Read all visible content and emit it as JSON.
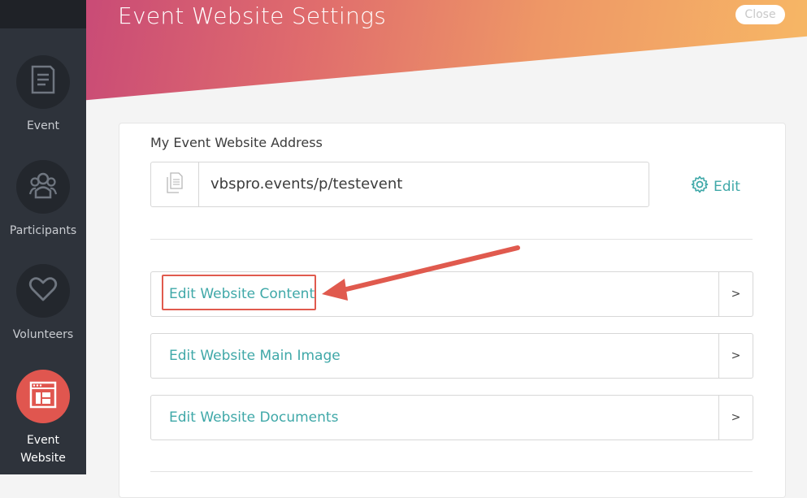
{
  "sidebar": {
    "items": [
      {
        "label": "Event",
        "icon": "document-icon",
        "active": false
      },
      {
        "label": "Participants",
        "icon": "people-icon",
        "active": false
      },
      {
        "label": "Volunteers",
        "icon": "heart-icon",
        "active": false
      },
      {
        "label": "Event\nWebsite",
        "icon": "website-icon",
        "active": true
      }
    ]
  },
  "header": {
    "title": "Event Website Settings",
    "close_label": "Close"
  },
  "address": {
    "label": "My Event Website Address",
    "value": "vbspro.events/p/testevent",
    "edit_label": "Edit"
  },
  "rows": [
    {
      "label": "Edit Website Content",
      "arrow": ">"
    },
    {
      "label": "Edit Website Main Image",
      "arrow": ">"
    },
    {
      "label": "Edit Website Documents",
      "arrow": ">"
    }
  ],
  "colors": {
    "accent": "#3fa8a8",
    "sidebar": "#2e333b",
    "active": "#e0564f",
    "annotation": "#e05a4e"
  }
}
